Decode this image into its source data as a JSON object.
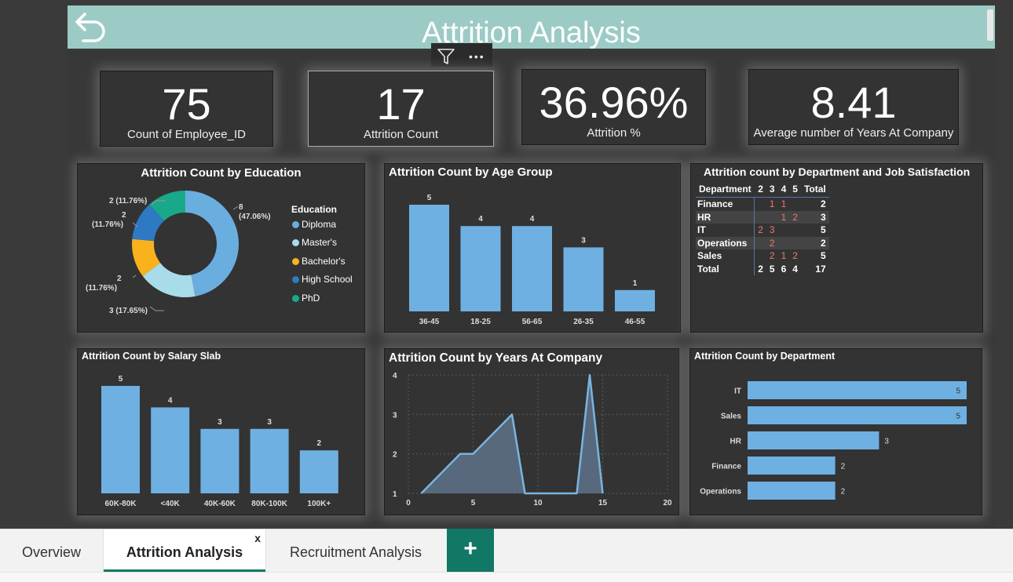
{
  "page_title": "Attrition Analysis",
  "colors": {
    "accent": "#9ccbc5",
    "bar": "#6fb0e2",
    "tab_active": "#117865"
  },
  "kpis": [
    {
      "value": "75",
      "label": "Count of Employee_ID"
    },
    {
      "value": "17",
      "label": "Attrition Count"
    },
    {
      "value": "36.96%",
      "label": "Attrition %"
    },
    {
      "value": "8.41",
      "label": "Average number  of Years At Company"
    }
  ],
  "education": {
    "title": "Attrition Count by Education",
    "legend_title": "Education",
    "legend": [
      {
        "label": "Diploma",
        "color": "#6aaee0"
      },
      {
        "label": "Master's",
        "color": "#a8dce8"
      },
      {
        "label": "Bachelor's",
        "color": "#f9b21c"
      },
      {
        "label": "High School",
        "color": "#2d79c4"
      },
      {
        "label": "PhD",
        "color": "#19a98a"
      }
    ],
    "slice_labels": {
      "diploma": [
        "8",
        "(47.06%)"
      ],
      "masters": "3 (17.65%)",
      "bachelors": [
        "2",
        "(11.76%)"
      ],
      "highschool": [
        "2",
        "(11.76%)"
      ],
      "phd": "2 (11.76%)"
    }
  },
  "matrix": {
    "title": "Attrition count by Department and Job Satisfaction",
    "headers": [
      "Department",
      "2",
      "3",
      "4",
      "5",
      "Total"
    ],
    "rows": [
      {
        "name": "Finance",
        "cells": [
          "",
          "1",
          "1",
          "",
          "2"
        ]
      },
      {
        "name": "HR",
        "cells": [
          "",
          "",
          "1",
          "2",
          "3"
        ]
      },
      {
        "name": "IT",
        "cells": [
          "2",
          "3",
          "",
          "",
          "5"
        ]
      },
      {
        "name": "Operations",
        "cells": [
          "",
          "2",
          "",
          "",
          "2"
        ]
      },
      {
        "name": "Sales",
        "cells": [
          "",
          "2",
          "1",
          "2",
          "5"
        ]
      }
    ],
    "total": {
      "name": "Total",
      "cells": [
        "2",
        "5",
        "6",
        "4",
        "17"
      ]
    }
  },
  "tabs": [
    {
      "label": "Overview"
    },
    {
      "label": "Attrition Analysis",
      "close": "x"
    },
    {
      "label": "Recruitment Analysis"
    }
  ],
  "add_tab_label": "+",
  "chart_data": [
    {
      "type": "pie",
      "title": "Attrition Count by Education",
      "categories": [
        "Diploma",
        "Master's",
        "Bachelor's",
        "High School",
        "PhD"
      ],
      "values": [
        8,
        3,
        2,
        2,
        2
      ],
      "percent": [
        47.06,
        17.65,
        11.76,
        11.76,
        11.76
      ]
    },
    {
      "type": "bar",
      "title": "Attrition Count by Age Group",
      "categories": [
        "36-45",
        "18-25",
        "56-65",
        "26-35",
        "46-55"
      ],
      "values": [
        5,
        4,
        4,
        3,
        1
      ],
      "ylim": [
        0,
        5
      ]
    },
    {
      "type": "table",
      "title": "Attrition count by Department and Job Satisfaction",
      "columns": [
        "2",
        "3",
        "4",
        "5",
        "Total"
      ],
      "rows": [
        "Finance",
        "HR",
        "IT",
        "Operations",
        "Sales",
        "Total"
      ]
    },
    {
      "type": "bar",
      "title": "Attrition Count by Salary Slab",
      "categories": [
        "60K-80K",
        "<40K",
        "40K-60K",
        "80K-100K",
        "100K+"
      ],
      "values": [
        5,
        4,
        3,
        3,
        2
      ],
      "ylim": [
        0,
        5
      ]
    },
    {
      "type": "area",
      "title": "Attrition Count by Years At Company",
      "x": [
        1,
        4,
        5,
        8,
        9,
        10,
        11,
        12,
        13,
        14,
        15
      ],
      "y": [
        1,
        2,
        2,
        3,
        1,
        1,
        1,
        1,
        1,
        4,
        1
      ],
      "xlim": [
        0,
        20
      ],
      "ylim": [
        1,
        4
      ],
      "xticks": [
        0,
        5,
        10,
        15,
        20
      ],
      "yticks": [
        1,
        2,
        3,
        4
      ],
      "grid": true
    },
    {
      "type": "bar",
      "orientation": "horizontal",
      "title": "Attrition Count by Department",
      "categories": [
        "IT",
        "Sales",
        "HR",
        "Finance",
        "Operations"
      ],
      "values": [
        5,
        5,
        3,
        2,
        2
      ],
      "xlim": [
        0,
        5
      ]
    }
  ]
}
